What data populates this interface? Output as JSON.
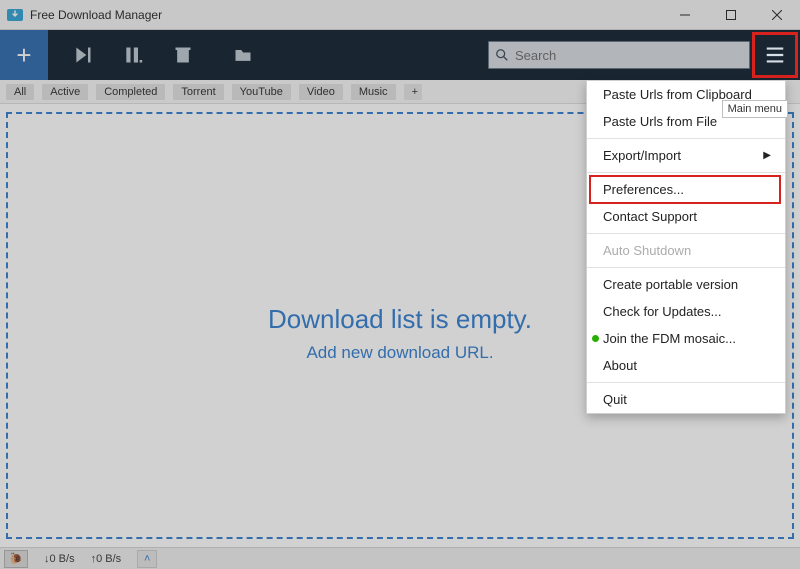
{
  "titlebar": {
    "title": "Free Download Manager"
  },
  "toolbar": {
    "search_placeholder": "Search"
  },
  "filters": {
    "items": [
      "All",
      "Active",
      "Completed",
      "Torrent",
      "YouTube",
      "Video",
      "Music"
    ]
  },
  "empty": {
    "line1": "Download list is empty.",
    "line2": "Add new download URL."
  },
  "status": {
    "down": "↓0 B/s",
    "up": "↑0 B/s"
  },
  "tooltip": "Main menu",
  "menu": {
    "paste_clipboard": "Paste Urls from Clipboard",
    "paste_file": "Paste Urls from File",
    "export_import": "Export/Import",
    "preferences": "Preferences...",
    "contact": "Contact Support",
    "auto_shutdown": "Auto Shutdown",
    "portable": "Create portable version",
    "updates": "Check for Updates...",
    "mosaic": "Join the FDM mosaic...",
    "about": "About",
    "quit": "Quit"
  }
}
